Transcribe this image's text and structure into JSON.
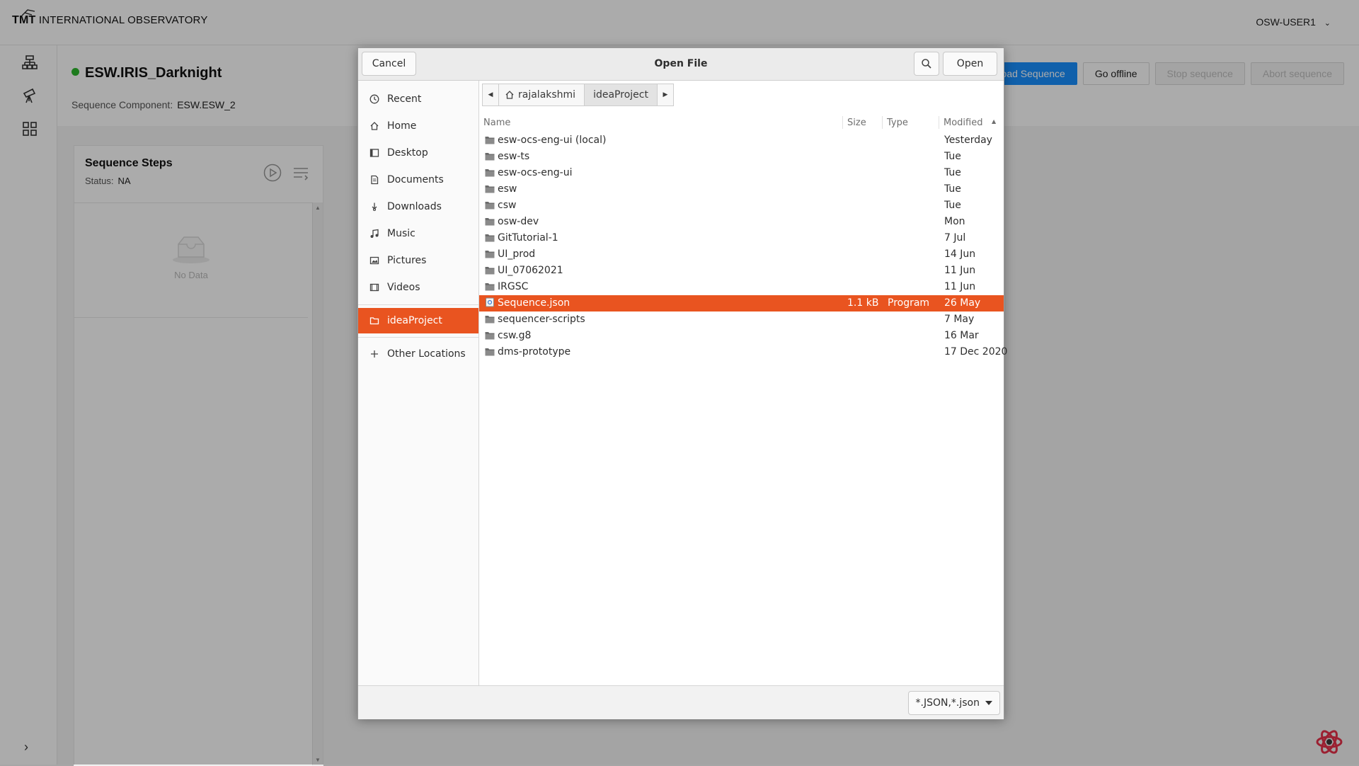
{
  "app": {
    "brand_bold": "TMT",
    "brand_rest": "INTERNATIONAL OBSERVATORY",
    "user": "OSW-USER1",
    "sequencer_title": "ESW.IRIS_Darknight",
    "sequence_component_label": "Sequence Component:",
    "sequence_component_value": "ESW.ESW_2",
    "buttons": {
      "load": "Load Sequence",
      "offline": "Go offline",
      "stop": "Stop sequence",
      "abort": "Abort sequence"
    },
    "steps": {
      "title": "Sequence Steps",
      "status_label": "Status:",
      "status_value": "NA",
      "empty_text": "No Data"
    },
    "colors": {
      "online_dot": "#2db82d",
      "primary": "#1890ff",
      "selection": "#e95420"
    }
  },
  "dialog": {
    "title": "Open File",
    "cancel": "Cancel",
    "open": "Open",
    "places": [
      {
        "label": "Recent",
        "icon": "clock-icon"
      },
      {
        "label": "Home",
        "icon": "home-icon"
      },
      {
        "label": "Desktop",
        "icon": "desktop-icon"
      },
      {
        "label": "Documents",
        "icon": "document-icon"
      },
      {
        "label": "Downloads",
        "icon": "download-icon"
      },
      {
        "label": "Music",
        "icon": "music-icon"
      },
      {
        "label": "Pictures",
        "icon": "picture-icon"
      },
      {
        "label": "Videos",
        "icon": "video-icon"
      },
      {
        "label": "ideaProject",
        "icon": "folder-icon"
      },
      {
        "label": "Other Locations",
        "icon": "plus-icon"
      }
    ],
    "path": [
      "rajalakshmi",
      "ideaProject"
    ],
    "columns": {
      "name": "Name",
      "size": "Size",
      "type": "Type",
      "modified": "Modified"
    },
    "files": [
      {
        "name": "esw-ocs-eng-ui (local)",
        "size": "",
        "type": "",
        "modified": "Yesterday"
      },
      {
        "name": "esw-ts",
        "size": "",
        "type": "",
        "modified": "Tue"
      },
      {
        "name": "esw-ocs-eng-ui",
        "size": "",
        "type": "",
        "modified": "Tue"
      },
      {
        "name": "esw",
        "size": "",
        "type": "",
        "modified": "Tue"
      },
      {
        "name": "csw",
        "size": "",
        "type": "",
        "modified": "Tue"
      },
      {
        "name": "osw-dev",
        "size": "",
        "type": "",
        "modified": "Mon"
      },
      {
        "name": "GitTutorial-1",
        "size": "",
        "type": "",
        "modified": "7 Jul"
      },
      {
        "name": "UI_prod",
        "size": "",
        "type": "",
        "modified": "14 Jun"
      },
      {
        "name": "UI_07062021",
        "size": "",
        "type": "",
        "modified": "11 Jun"
      },
      {
        "name": "IRGSC",
        "size": "",
        "type": "",
        "modified": "11 Jun"
      },
      {
        "name": "Sequence.json",
        "size": "1.1 kB",
        "type": "Program",
        "modified": "26 May"
      },
      {
        "name": "sequencer-scripts",
        "size": "",
        "type": "",
        "modified": "7 May"
      },
      {
        "name": "csw.g8",
        "size": "",
        "type": "",
        "modified": "16 Mar"
      },
      {
        "name": "dms-prototype",
        "size": "",
        "type": "",
        "modified": "17 Dec 2020"
      }
    ],
    "filter": "*.JSON,*.json"
  }
}
